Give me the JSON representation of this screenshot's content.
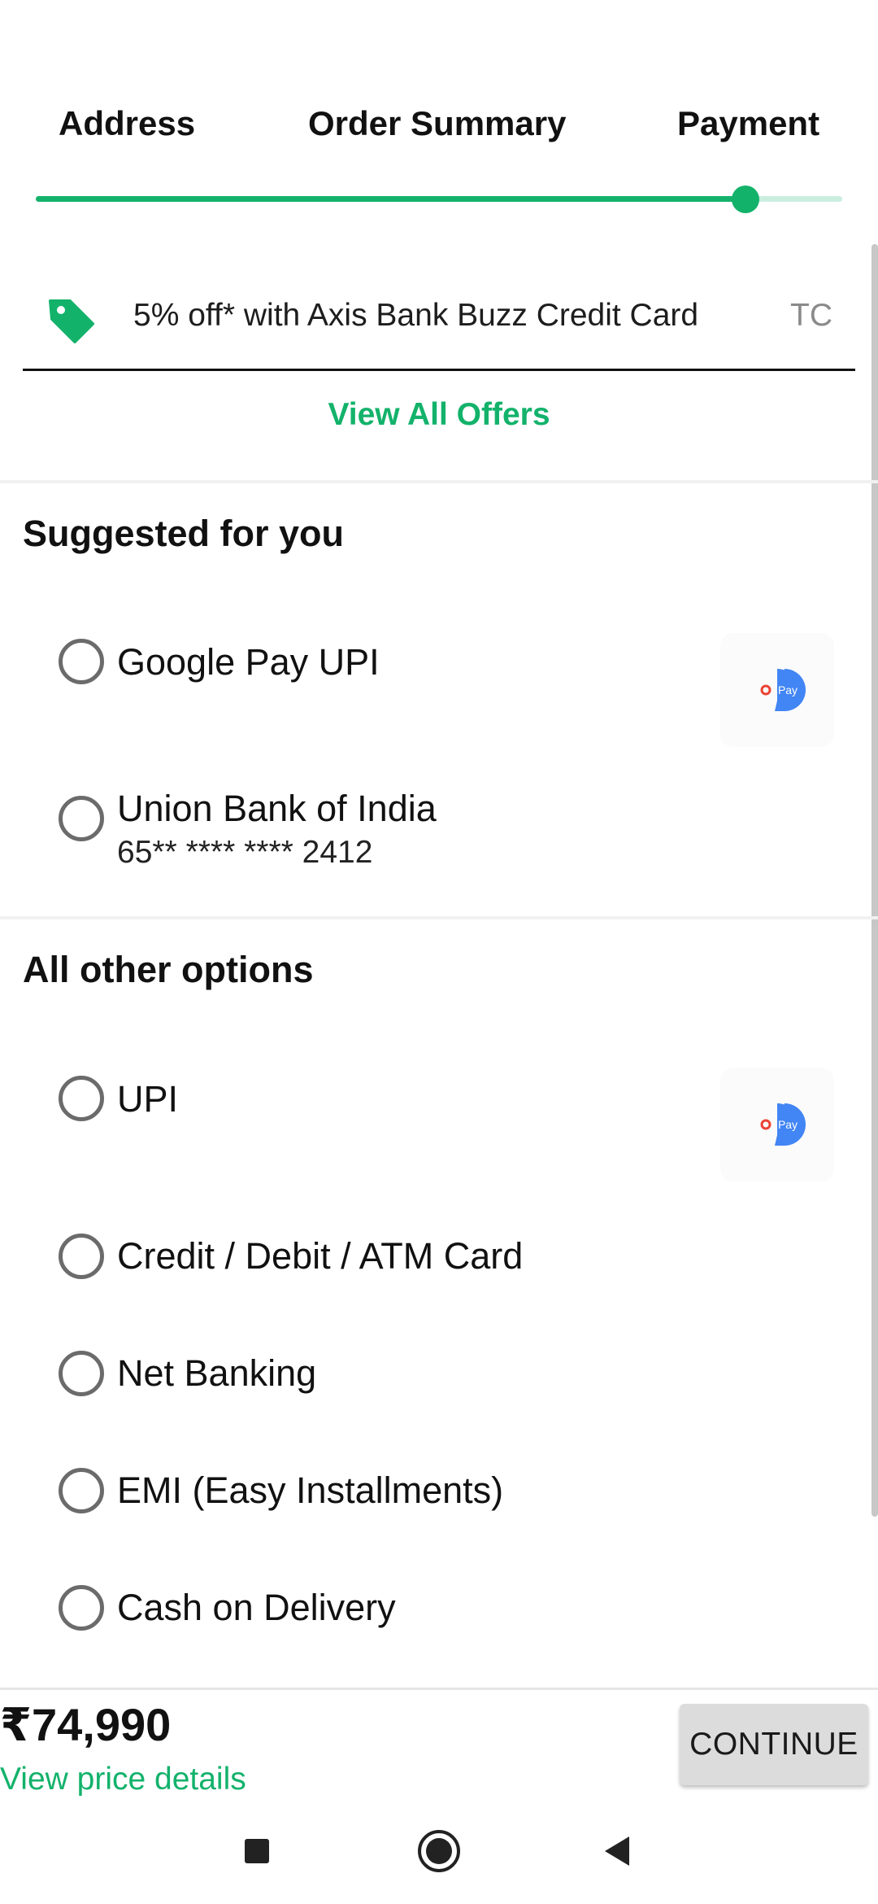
{
  "stepper": {
    "steps": [
      "Address",
      "Order Summary",
      "Payment"
    ],
    "active_step": "Payment",
    "progress_fraction": 0.88
  },
  "offer": {
    "text": "5% off* with Axis Bank Buzz Credit Card",
    "tc": "TC",
    "icon": "price-tag-icon",
    "view_all": "View All Offers"
  },
  "suggested": {
    "title": "Suggested for you",
    "options": [
      {
        "label": "Google Pay UPI",
        "icon": "google-pay-icon",
        "selected": false
      },
      {
        "label": "Union Bank of India",
        "sub": "65** **** **** 2412",
        "selected": false
      }
    ]
  },
  "other": {
    "title": "All other options",
    "options": [
      {
        "label": "UPI",
        "icon": "google-pay-icon",
        "selected": false
      },
      {
        "label": "Credit / Debit / ATM Card",
        "selected": false
      },
      {
        "label": "Net Banking",
        "selected": false
      },
      {
        "label": "EMI (Easy Installments)",
        "selected": false
      },
      {
        "label": "Cash on Delivery",
        "selected": false
      }
    ]
  },
  "gpay_text": "Pay",
  "footer": {
    "price": "₹74,990",
    "price_link": "View price details",
    "continue_label": "CONTINUE"
  },
  "colors": {
    "accent": "#13b26b",
    "track_bg": "#c9eee0",
    "gpay_blue": "#4285f4"
  },
  "navbar": {
    "icons": [
      "recents-square-icon",
      "home-circle-icon",
      "back-triangle-icon"
    ]
  }
}
